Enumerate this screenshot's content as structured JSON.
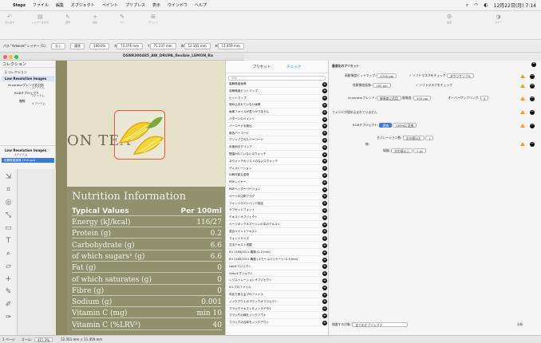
{
  "menubar": {
    "app_name": "Stepz",
    "items": [
      "ファイル",
      "編集",
      "オブジェクト",
      "ペイント",
      "プリプレス",
      "表示",
      "ウインドウ",
      "ヘルプ"
    ],
    "clock": "12月22日(月) 7:14"
  },
  "toolbar": {
    "items": [
      {
        "icon": "undo-icon",
        "label": "元に戻す"
      },
      {
        "icon": "layers-icon",
        "label": "レイヤーを表示"
      },
      {
        "icon": "cursor-icon",
        "label": "選択"
      },
      {
        "icon": "plus-icon",
        "label": "追加"
      },
      {
        "icon": "pen-icon",
        "label": "ペン"
      },
      {
        "icon": "grid-icon",
        "label": "グリッド"
      },
      {
        "icon": "gear-icon",
        "label": "設定"
      },
      {
        "icon": "color-icon",
        "label": "カラー"
      }
    ]
  },
  "ctrlbar": {
    "path": "パス \"Artwork\" レイヤー (1):",
    "none": "なし",
    "blend": "通常",
    "opacity": "100.0%",
    "x": "73.476 mm",
    "y": "71.237 mm",
    "w": "12.351 mm",
    "h": "11.459 mm"
  },
  "document": {
    "title": "DSNR300485_AW_DRUPA_flexible_LEMON_Ra"
  },
  "leftpanel": {
    "header": "コレクション",
    "collection": "1 コレクション",
    "selected": "Low Resolution Images",
    "items": [
      {
        "name": "Illustratorブレンドの分析",
        "count": "1アイテム"
      },
      {
        "name": "RGBオブジェクト",
        "count": "1アイテム"
      },
      {
        "name": "複線",
        "count": "4 アイテム"
      }
    ],
    "lowres_title": "Low Resolution Images",
    "lowres_count": "1アイテム",
    "lowres_item": "低解像度画像 (150 ppi)"
  },
  "label": {
    "tea": "ON TEA",
    "nutrition_title": "Nutrition Information",
    "head_left": "Typical Values",
    "head_right": "Per 100ml",
    "rows": [
      {
        "name": "Energy (kJ/kcal)",
        "value": "116/27"
      },
      {
        "name": "Protein (g)",
        "value": "0.2"
      },
      {
        "name": "Carbohydrate (g)",
        "value": "6.6"
      },
      {
        "name": "of which sugars¹ (g)",
        "value": "6.6"
      },
      {
        "name": "Fat (g)",
        "value": "0"
      },
      {
        "name": "of which saturates (g)",
        "value": "0"
      },
      {
        "name": "Fibre (g)",
        "value": "0"
      },
      {
        "name": "Sodium (g)",
        "value": "0.001"
      },
      {
        "name": "Vitamin C (mg)",
        "value": "min 10"
      },
      {
        "name": "Vitamin C (%LRV²)",
        "value": "40"
      }
    ]
  },
  "preflight": {
    "tab_preset": "プリセット",
    "tab_check": "チェック",
    "search_placeholder": "検索",
    "items": [
      "高解像度画像",
      "低解像度ビットマップ",
      "ビットマップ",
      "埋め込まれていない画像",
      "画像ファイルが見つかりません",
      "パターンのペイント",
      "バーコードを検出",
      "無色バーコード",
      "クリップされたバーコード",
      "未使用のクリップ",
      "間違われていないスウォッチ",
      "スウォッチのリストのないスウォッチ",
      "ディストーション",
      "印刷可能な金物",
      "PDFレイヤー",
      "PDFヘッダーバージョン",
      "ページの注釈フラグ",
      "フォントのエンベッド指定",
      "サブセットフォント",
      "テキストオブジェクト",
      "ページボックスマージンの中のテキスト",
      "混合ペイントテキスト",
      "フォントサイズ",
      "文字テキスト書類",
      "EU 1169/2011 義務 (1.2 mm)",
      "EU 1169/2011 義務 (スモールパッケージ: 0.9 mm)",
      "Labオブジェクト",
      "Grayオブジェクト",
      "レジストレーションオブジェクト",
      "ICCプロファイル",
      "対応で使えるプロファイル",
      "ノックアウトのブラックオブジェクト",
      "ブラックテキストをノックアウト",
      "ブラックの線をノックアウト",
      "ブラックの合体をノックアウト"
    ]
  },
  "settings": {
    "section1": "最適化のプリセット",
    "row_hi_label": "高解像度ビットマップ:",
    "row_hi_value": "1200 ppi",
    "row_hi_check": "ソフトマスクをチェック",
    "row_hi_btn": "ダウンサンプル",
    "row_lo_label": "低解像度画像:",
    "row_lo_value": "100 ppi",
    "row_lo_check": "ソフトマスクをチェック",
    "row_ill_label": "Illustratorブレンド:",
    "row_ill_btn1": "解像度に応用",
    "row_ill_res_label": "解像度:",
    "row_ill_res": "300 ppi",
    "row_ill_overprint": "オーバーサンプリング:",
    "row_ill_os": "4",
    "row_font": "フォントが埋め込まれていません",
    "rgb_label": "RGBオブジェクト:",
    "rgb_btn1": "変換",
    "rgb_btn2": "CMYKに変換",
    "sep_label": "セパレーション数:",
    "sep_op": "次の値以上",
    "sep_val": "1",
    "line_label": "線:",
    "line2_label": "幅幅:",
    "line2_op": "次の値以上",
    "line2_val": "1 pt",
    "bottom_label": "検査する対象:",
    "bottom_value": "全てのオブジェクト",
    "bottom_right": "分析"
  },
  "statusbar": {
    "page": "1 ページ",
    "zoom_label": "ズーム:",
    "zoom": "415.3%",
    "coords": "12.351 mm × 11.459 mm"
  },
  "colors": {
    "accent": "#3a7bd5",
    "warning": "#f0a020",
    "selection": "#e85a3a",
    "nutrition_bg": "#92916e",
    "canvas_bg": "#8d8a63"
  }
}
